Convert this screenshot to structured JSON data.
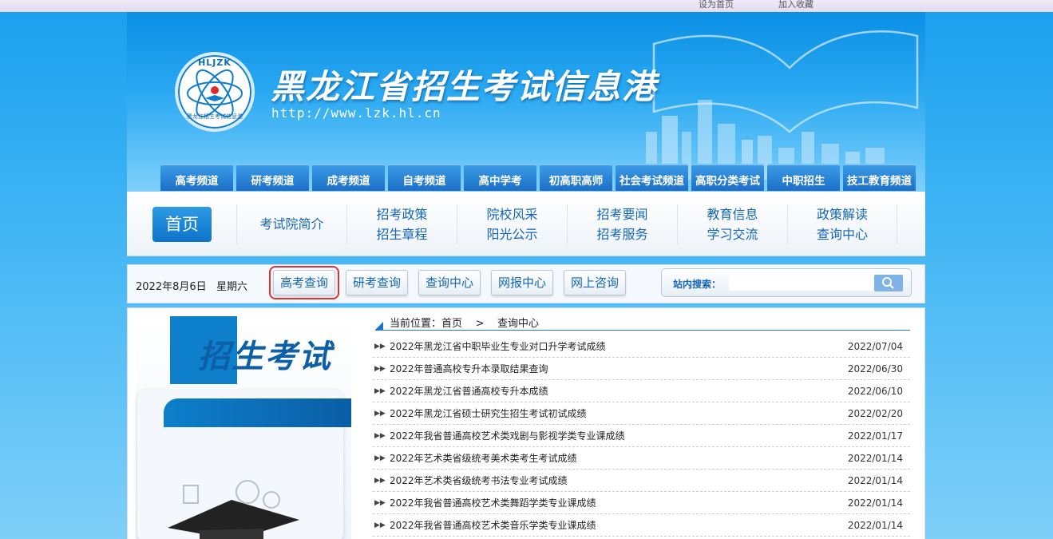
{
  "topbar": {
    "links": [
      "设为首页",
      "加入收藏"
    ]
  },
  "header": {
    "logo_text": "HLJZK",
    "logo_subtext": "黑龙江招生考试信息港",
    "title": "黑龙江省招生考试信息港",
    "url": "http://www.lzk.hl.cn",
    "channels": [
      "高考频道",
      "研考频道",
      "成考频道",
      "自考频道",
      "高中学考",
      "初高职高师",
      "社会考试频道",
      "高职分类考试",
      "中职招生",
      "技工教育频道"
    ]
  },
  "nav": {
    "home": "首页",
    "columns": [
      {
        "top": "考试院简介",
        "bottom": ""
      },
      {
        "top": "招考政策",
        "bottom": "招生章程"
      },
      {
        "top": "院校风采",
        "bottom": "阳光公示"
      },
      {
        "top": "招考要闻",
        "bottom": "招考服务"
      },
      {
        "top": "教育信息",
        "bottom": "学习交流"
      },
      {
        "top": "政策解读",
        "bottom": "查询中心"
      }
    ]
  },
  "toolbar": {
    "date": "2022年8月6日",
    "weekday": "星期六",
    "buttons": [
      "高考查询",
      "研考查询",
      "查询中心",
      "网报中心",
      "网上咨询"
    ],
    "search_label": "站内搜索：",
    "search_value": ""
  },
  "content": {
    "banner_title": "招生考试",
    "breadcrumb": {
      "prefix": "当前位置：",
      "home": "首页",
      "separator": ">",
      "current": "查询中心"
    },
    "items": [
      {
        "title": "2022年黑龙江省中职毕业生专业对口升学考试成绩",
        "date": "2022/07/04"
      },
      {
        "title": "2022年普通高校专升本录取结果查询",
        "date": "2022/06/30"
      },
      {
        "title": "2022年黑龙江省普通高校专升本成绩",
        "date": "2022/06/10"
      },
      {
        "title": "2022年黑龙江省硕士研究生招生考试初试成绩",
        "date": "2022/02/20"
      },
      {
        "title": "2022年我省普通高校艺术类戏剧与影视学类专业课成绩",
        "date": "2022/01/17"
      },
      {
        "title": "2022年艺术类省级统考美术类考生考试成绩",
        "date": "2022/01/14"
      },
      {
        "title": "2022年艺术类省级统考书法专业考试成绩",
        "date": "2022/01/14"
      },
      {
        "title": "2022年我省普通高校艺术类舞蹈学类专业课成绩",
        "date": "2022/01/14"
      },
      {
        "title": "2022年我省普通高校艺术类音乐学类专业课成绩",
        "date": "2022/01/14"
      }
    ]
  }
}
